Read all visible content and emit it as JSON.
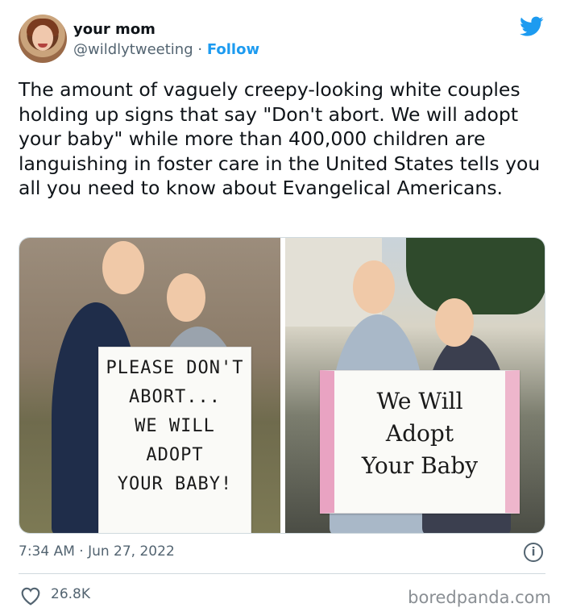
{
  "author": {
    "name": "your mom",
    "handle": "@wildlytweeting",
    "separator": "·",
    "follow_label": "Follow"
  },
  "tweet_text": "The amount of vaguely creepy-looking white couples holding up signs that say \"Don't abort. We will adopt your baby\" while more than 400,000 children are languishing in foster care in the United States tells you all you need to know about Evangelical Americans.",
  "photos": {
    "left_sign_lines": [
      "PLEASE DON'T",
      "ABORT...",
      "WE WILL",
      "ADOPT",
      "YOUR BABY!"
    ],
    "right_sign_lines": [
      "We Will",
      "Adopt",
      "Your Baby"
    ]
  },
  "timestamp": "7:34 AM · Jun 27, 2022",
  "info_label": "i",
  "like_count": "26.8K",
  "watermark": "boredpanda.com",
  "icons": [
    "twitter-bird-icon",
    "info-icon",
    "heart-icon"
  ],
  "colors": {
    "accent": "#1d9bf0",
    "muted": "#536471",
    "text": "#0f1419"
  }
}
